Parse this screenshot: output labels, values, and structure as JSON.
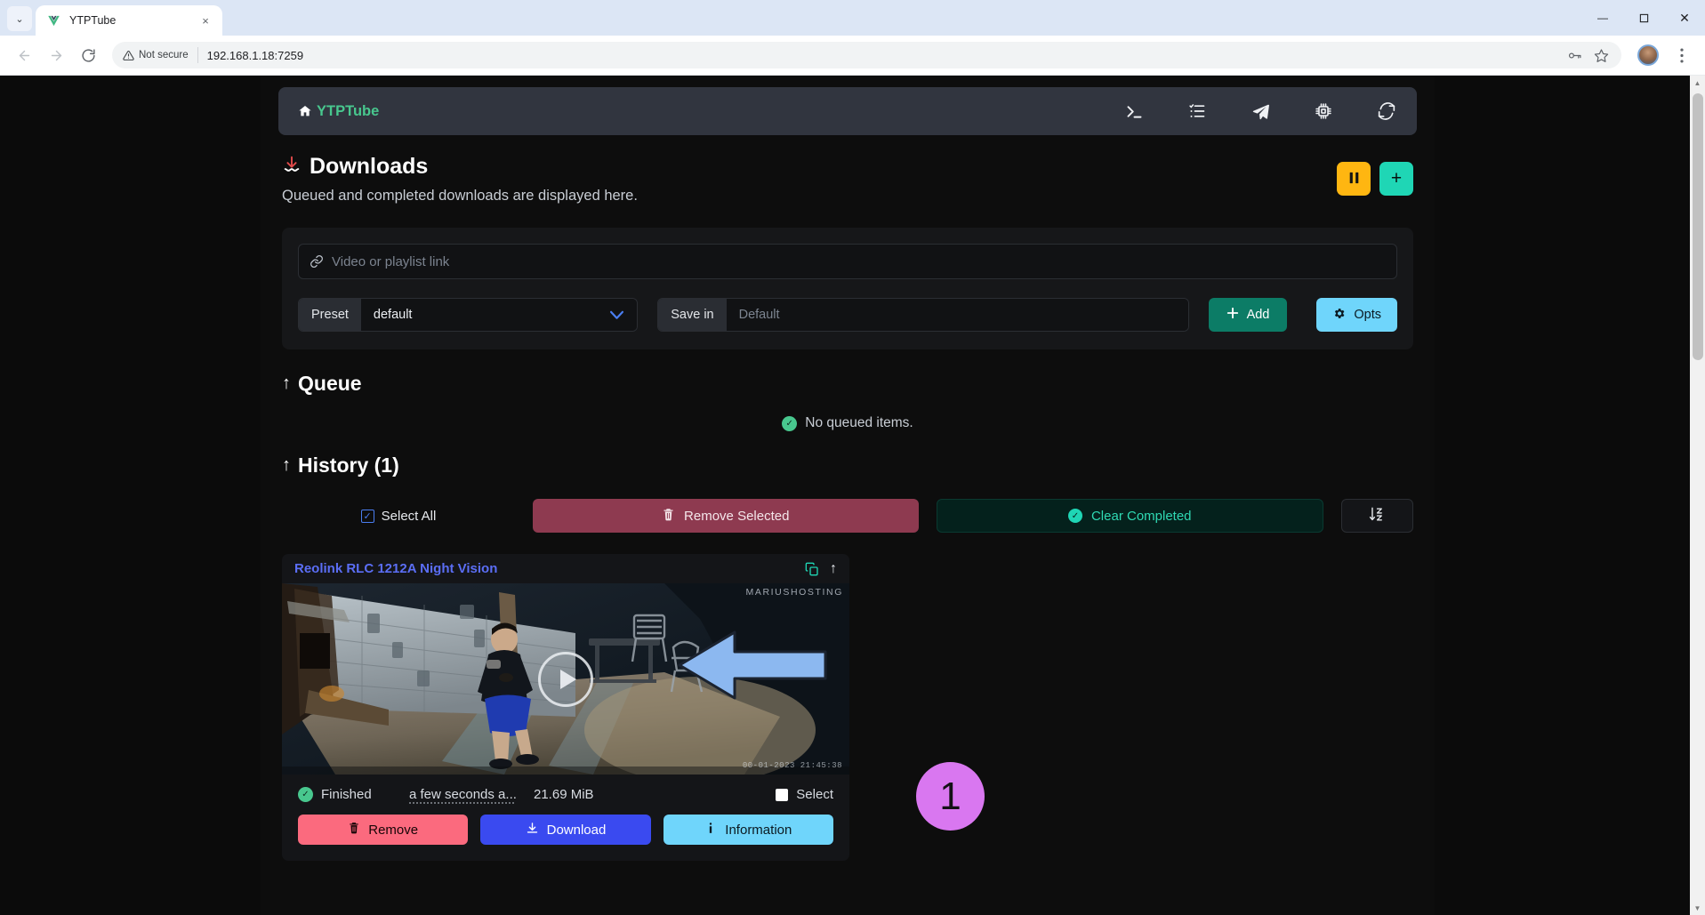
{
  "browser": {
    "tab": {
      "title": "YTPTube",
      "favicon": "vue-logo-icon",
      "close": "×"
    },
    "tab_list_chevron": "⌄",
    "window_controls": {
      "minimize": "—",
      "maximize": "❐",
      "close": "✕"
    },
    "nav": {
      "back": "←",
      "forward": "→",
      "reload": "⟳"
    },
    "security_label": "Not secure",
    "url": "192.168.1.18:7259",
    "toolbar_icons": [
      "password-key-icon",
      "bookmark-star-icon",
      "profile-avatar",
      "chrome-menu-kebab"
    ]
  },
  "app": {
    "brand": "YTPTube",
    "navbar_icons": [
      {
        "name": "terminal-icon",
        "glyph": ">_"
      },
      {
        "name": "task-list-icon",
        "glyph": "list"
      },
      {
        "name": "send-paper-plane-icon",
        "glyph": "plane"
      },
      {
        "name": "cpu-chip-icon",
        "glyph": "chip"
      },
      {
        "name": "refresh-sync-icon",
        "glyph": "sync"
      }
    ],
    "page": {
      "title": "Downloads",
      "subtitle": "Queued and completed downloads are displayed here.",
      "pause_button": "pause-icon",
      "add_button": "+"
    },
    "form": {
      "link_placeholder": "Video or playlist link",
      "preset_label": "Preset",
      "preset_value": "default",
      "savein_label": "Save in",
      "savein_placeholder": "Default",
      "add_label": "Add",
      "opts_label": "Opts"
    },
    "queue": {
      "heading": "Queue",
      "empty_text": "No queued items."
    },
    "history": {
      "heading": "History (1)",
      "select_all_label": "Select All",
      "remove_selected_label": "Remove Selected",
      "clear_completed_label": "Clear Completed",
      "sort_label": "sort-az-icon"
    },
    "card": {
      "title": "Reolink RLC 1212A Night Vision",
      "copy_icon": "copy-icon",
      "expand_icon": "arrow-up-icon",
      "thumbnail": {
        "watermark": "MARIUSHOSTING",
        "timestamp": "00-01-2023  21:45:38",
        "play_overlay": "play-button-icon"
      },
      "status": "Finished",
      "time_ago": "a few seconds a...",
      "size": "21.69 MiB",
      "select_label": "Select",
      "buttons": {
        "remove": "Remove",
        "download": "Download",
        "information": "Information"
      }
    }
  },
  "annotation": {
    "step_number": "1",
    "arrow_color": "#8cb8f0",
    "badge_color": "#d977f0"
  }
}
